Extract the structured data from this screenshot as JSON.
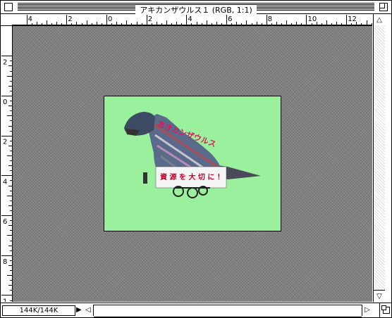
{
  "window": {
    "title": "アキカンザウルス１ (RGB, 1:1)"
  },
  "rulers": {
    "horizontal_labels": [
      "4",
      "2",
      "0",
      "2",
      "4",
      "6",
      "8",
      "10",
      "12"
    ],
    "vertical_labels": [
      "2",
      "0",
      "2",
      "4",
      "6",
      "8",
      "1"
    ]
  },
  "image": {
    "banner_text": "資 源 を 大 切 に ！",
    "sign_text": "あきカンザウルス"
  },
  "status": {
    "size_text": "144K/144K"
  },
  "colors": {
    "background_green": "#9af09c",
    "canvas_gray": "#808080"
  },
  "icons": {
    "close": "close-box-icon",
    "zoom": "zoom-box-icon",
    "scroll_up": "up-arrow-icon",
    "scroll_down": "down-arrow-icon",
    "scroll_left": "left-arrow-icon",
    "scroll_right": "right-arrow-icon",
    "grow": "size-box-icon"
  }
}
